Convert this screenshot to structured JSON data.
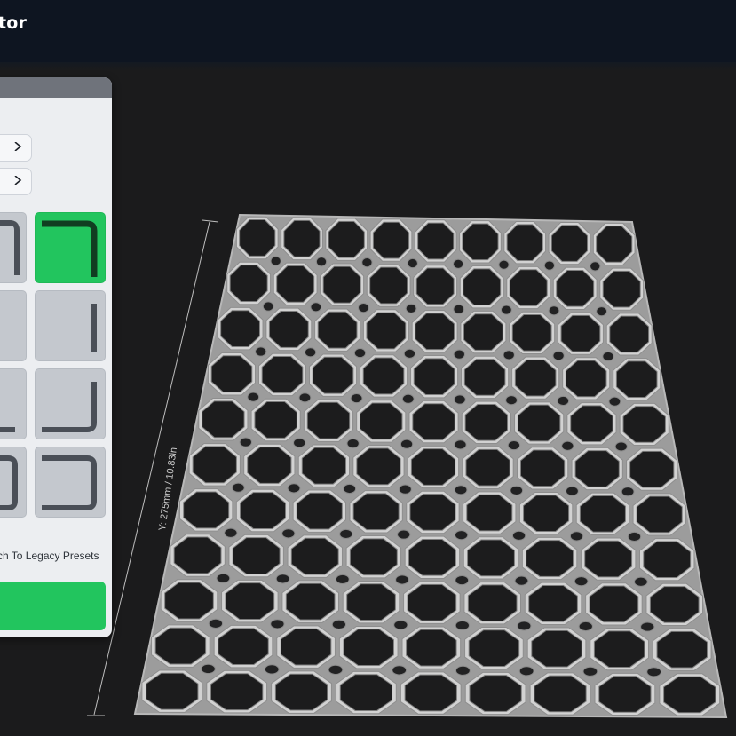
{
  "app": {
    "title": "tor"
  },
  "panel": {
    "legacy_link": "itch To Legacy Presets"
  },
  "tiles": {
    "selected_index": 1,
    "icons": [
      "corner-top-left-icon",
      "corner-top-right-icon",
      "edge-right-icon",
      "corner-bottom-right-icon",
      "u-shape-left-icon",
      "u-shape-right-icon"
    ]
  },
  "viewport": {
    "dimension_label": "Y: 275mm / 10.83in",
    "grid": {
      "rows": 11,
      "cols": 9
    }
  },
  "colors": {
    "accent": "#22c55e",
    "topbar": "#0e1521",
    "background": "#1b1b1c",
    "model": "#cfcfcf",
    "panel": "#eceef1"
  }
}
